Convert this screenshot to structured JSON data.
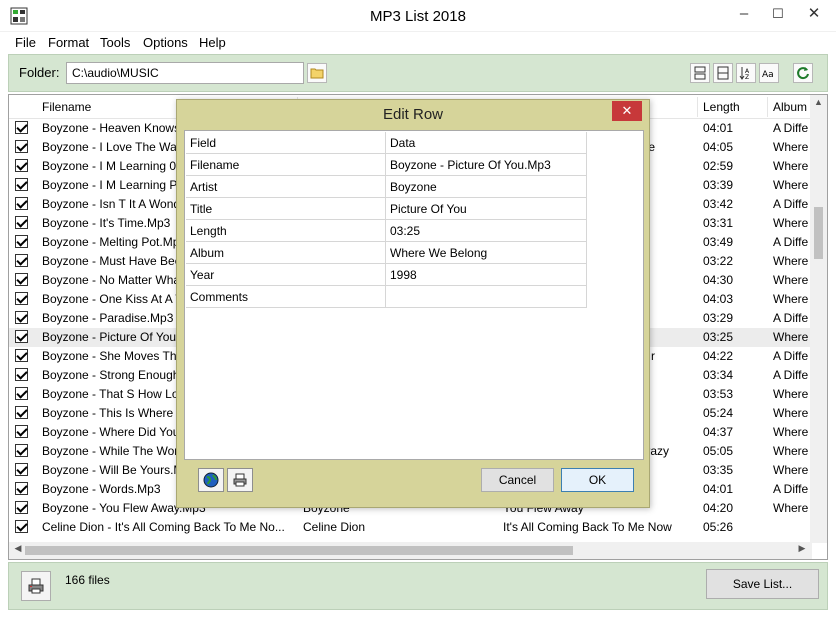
{
  "window": {
    "title": "MP3 List 2018",
    "minimize": "–",
    "maximize": "☐",
    "close": "✕"
  },
  "menu": [
    "File",
    "Format",
    "Tools",
    "Options",
    "Help"
  ],
  "folder": {
    "label": "Folder:",
    "value": "C:\\audio\\MUSIC"
  },
  "columns": {
    "filename": "Filename",
    "length": "Length",
    "album": "Album"
  },
  "rows": [
    {
      "filename": "Boyzone - Heaven Knows",
      "artist": "",
      "title": "",
      "length": "04:01",
      "album": "A Diffe"
    },
    {
      "filename": "Boyzone - I Love The Way",
      "artist": "",
      "title": "e",
      "length": "04:05",
      "album": "Where"
    },
    {
      "filename": "Boyzone - I M Learning  0",
      "artist": "",
      "title": "",
      "length": "02:59",
      "album": "Where"
    },
    {
      "filename": "Boyzone - I M Learning  P",
      "artist": "",
      "title": "",
      "length": "03:39",
      "album": "Where"
    },
    {
      "filename": "Boyzone - Isn T It A Wond",
      "artist": "",
      "title": "",
      "length": "03:42",
      "album": "A Diffe"
    },
    {
      "filename": "Boyzone - It's Time.Mp3",
      "artist": "",
      "title": "",
      "length": "03:31",
      "album": "Where"
    },
    {
      "filename": "Boyzone - Melting Pot.Mp",
      "artist": "",
      "title": "",
      "length": "03:49",
      "album": "A Diffe"
    },
    {
      "filename": "Boyzone - Must Have Bee",
      "artist": "",
      "title": "",
      "length": "03:22",
      "album": "Where"
    },
    {
      "filename": "Boyzone - No Matter Wha",
      "artist": "",
      "title": "",
      "length": "04:30",
      "album": "Where"
    },
    {
      "filename": "Boyzone - One Kiss At A T",
      "artist": "",
      "title": "",
      "length": "04:03",
      "album": "Where"
    },
    {
      "filename": "Boyzone - Paradise.Mp3",
      "artist": "",
      "title": "",
      "length": "03:29",
      "album": "A Diffe"
    },
    {
      "filename": "Boyzone - Picture Of You",
      "artist": "",
      "title": "",
      "length": "03:25",
      "album": "Where",
      "selected": true
    },
    {
      "filename": "Boyzone - She Moves Thr",
      "artist": "",
      "title": "r",
      "length": "04:22",
      "album": "A Diffe"
    },
    {
      "filename": "Boyzone - Strong Enough",
      "artist": "",
      "title": "",
      "length": "03:34",
      "album": "A Diffe"
    },
    {
      "filename": "Boyzone - That S How Lo",
      "artist": "",
      "title": "",
      "length": "03:53",
      "album": "Where"
    },
    {
      "filename": "Boyzone - This Is Where I",
      "artist": "",
      "title": "",
      "length": "05:24",
      "album": "Where"
    },
    {
      "filename": "Boyzone - Where Did You",
      "artist": "",
      "title": "",
      "length": "04:37",
      "album": "Where"
    },
    {
      "filename": "Boyzone - While The Wor",
      "artist": "",
      "title": "razy",
      "length": "05:05",
      "album": "Where"
    },
    {
      "filename": "Boyzone - Will Be Yours.M",
      "artist": "",
      "title": "",
      "length": "03:35",
      "album": "Where"
    },
    {
      "filename": "Boyzone - Words.Mp3",
      "artist": "",
      "title": "",
      "length": "04:01",
      "album": "A Diffe"
    },
    {
      "filename": "Boyzone - You Flew Away.Mp3",
      "artist": "Boyzone",
      "title": "You Flew Away",
      "length": "04:20",
      "album": "Where"
    },
    {
      "filename": "Celine Dion - It's All Coming Back To Me No...",
      "artist": "Celine Dion",
      "title": "It's All Coming Back To Me Now",
      "length": "05:26",
      "album": ""
    }
  ],
  "status": {
    "count": "166 files",
    "save_label": "Save List..."
  },
  "dialog": {
    "title": "Edit Row",
    "close": "✕",
    "header": {
      "field": "Field",
      "data": "Data"
    },
    "fields": [
      {
        "field": "Filename",
        "data": "Boyzone - Picture Of You.Mp3"
      },
      {
        "field": "Artist",
        "data": "Boyzone"
      },
      {
        "field": "Title",
        "data": "Picture Of You"
      },
      {
        "field": "Length",
        "data": "03:25"
      },
      {
        "field": "Album",
        "data": "Where We Belong"
      },
      {
        "field": "Year",
        "data": "1998"
      },
      {
        "field": "Comments",
        "data": ""
      }
    ],
    "cancel_label": "Cancel",
    "ok_label": "OK"
  },
  "colors": {
    "panel": "#d5e6d1",
    "dialog": "#d6d49a",
    "close": "#c7383a"
  }
}
